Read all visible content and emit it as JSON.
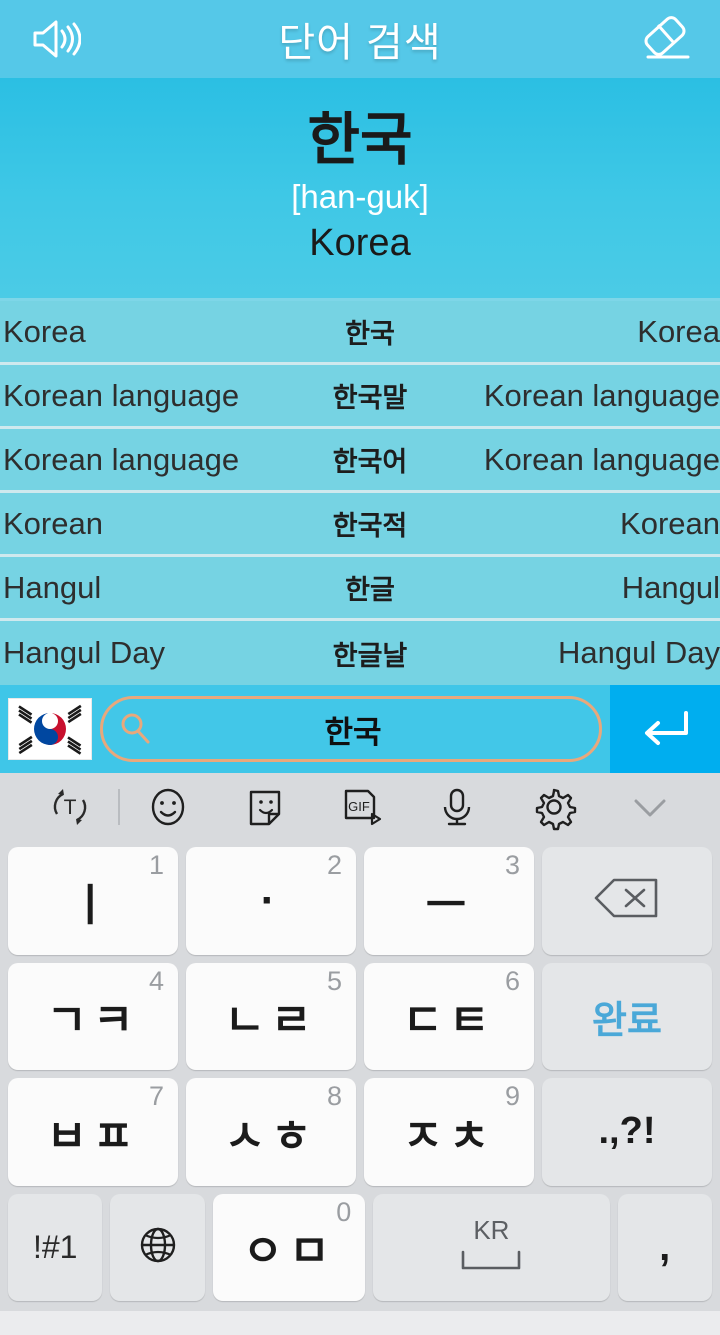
{
  "header": {
    "title": "단어 검색",
    "left_icon": "speaker-icon",
    "right_icon": "eraser-icon"
  },
  "hero": {
    "word": "한국",
    "romanization": "[han-guk]",
    "meaning": "Korea"
  },
  "results": {
    "rows": [
      {
        "left": "Korea",
        "korean": "한국",
        "right": "Korea"
      },
      {
        "left": "Korean language",
        "korean": "한국말",
        "right": "Korean language"
      },
      {
        "left": "Korean language",
        "korean": "한국어",
        "right": "Korean language"
      },
      {
        "left": "Korean",
        "korean": "한국적",
        "right": "Korean"
      },
      {
        "left": "Hangul",
        "korean": "한글",
        "right": "Hangul"
      },
      {
        "left": "Hangul Day",
        "korean": "한글날",
        "right": "Hangul Day"
      }
    ]
  },
  "search": {
    "flag": "korean-flag",
    "icon": "search-icon",
    "value": "한국",
    "placeholder": "한국",
    "enter_icon": "enter-arrow-icon"
  },
  "keyboard": {
    "toolbar": [
      {
        "name": "translate-icon",
        "label": "T"
      },
      {
        "name": "emoji-icon",
        "label": ""
      },
      {
        "name": "sticker-icon",
        "label": ""
      },
      {
        "name": "gif-icon",
        "label": "GIF"
      },
      {
        "name": "microphone-icon",
        "label": ""
      },
      {
        "name": "gear-icon",
        "label": ""
      },
      {
        "name": "chevron-down-icon",
        "label": ""
      }
    ],
    "rows": [
      [
        {
          "glyph": "ㅣ",
          "num": "1",
          "type": "char"
        },
        {
          "glyph": "·",
          "num": "2",
          "type": "char"
        },
        {
          "glyph": "ㅡ",
          "num": "3",
          "type": "char"
        },
        {
          "glyph": "",
          "num": "",
          "type": "backspace"
        }
      ],
      [
        {
          "glyph": "ㄱㅋ",
          "num": "4",
          "type": "char"
        },
        {
          "glyph": "ㄴㄹ",
          "num": "5",
          "type": "char"
        },
        {
          "glyph": "ㄷㅌ",
          "num": "6",
          "type": "char"
        },
        {
          "glyph": "완료",
          "num": "",
          "type": "done"
        }
      ],
      [
        {
          "glyph": "ㅂㅍ",
          "num": "7",
          "type": "char"
        },
        {
          "glyph": "ㅅㅎ",
          "num": "8",
          "type": "char"
        },
        {
          "glyph": "ㅈㅊ",
          "num": "9",
          "type": "char"
        },
        {
          "glyph": ".,?!",
          "num": "",
          "type": "punct"
        }
      ]
    ],
    "bottom_row": {
      "symbols": "!#1",
      "globe": "globe-icon",
      "vowel": "ㅇㅁ",
      "vowel_num": "0",
      "space_label": "KR",
      "comma": ","
    }
  },
  "colors": {
    "header_blue": "#55c8e8",
    "hero_blue": "#3fc8e6",
    "list_blue": "#76d3e3",
    "search_blue": "#3fc6e8",
    "enter_blue": "#00aeef",
    "field_border": "#e8a87c",
    "keyboard_bg": "#d8dadd",
    "key_white": "#fbfbfb",
    "key_gray": "#e4e6e8",
    "done_blue": "#4aa8d8"
  }
}
